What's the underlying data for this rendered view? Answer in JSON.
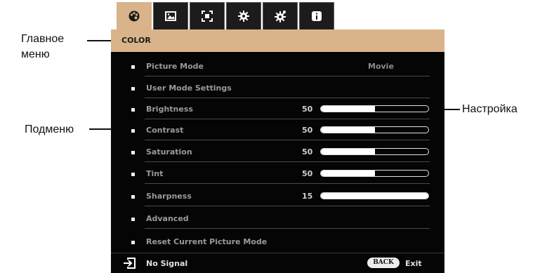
{
  "callouts": {
    "main_menu_line1": "Главное",
    "main_menu_line2": "меню",
    "submenu": "Подменю",
    "setting": "Настройка"
  },
  "tabs": [
    {
      "icon": "palette-icon",
      "active": true
    },
    {
      "icon": "image-icon",
      "active": false
    },
    {
      "icon": "screen-icon",
      "active": false
    },
    {
      "icon": "gear-icon",
      "active": false
    },
    {
      "icon": "advanced-gear-icon",
      "active": false
    },
    {
      "icon": "info-icon",
      "active": false
    }
  ],
  "menu_title": "COLOR",
  "items": [
    {
      "label": "Picture Mode",
      "mode_value": "Movie"
    },
    {
      "label": "User Mode Settings"
    },
    {
      "label": "Brightness",
      "value": "50",
      "level": 0.5
    },
    {
      "label": "Contrast",
      "value": "50",
      "level": 0.5
    },
    {
      "label": "Saturation",
      "value": "50",
      "level": 0.5
    },
    {
      "label": "Tint",
      "value": "50",
      "level": 0.5
    },
    {
      "label": "Sharpness",
      "value": "15",
      "level": 1.0
    },
    {
      "label": "Advanced"
    },
    {
      "label": "Reset Current Picture Mode"
    }
  ],
  "footer": {
    "status": "No Signal",
    "back_label": "BACK",
    "exit_label": "Exit"
  },
  "colors": {
    "accent": "#d9b48a",
    "panel": "#050505"
  }
}
